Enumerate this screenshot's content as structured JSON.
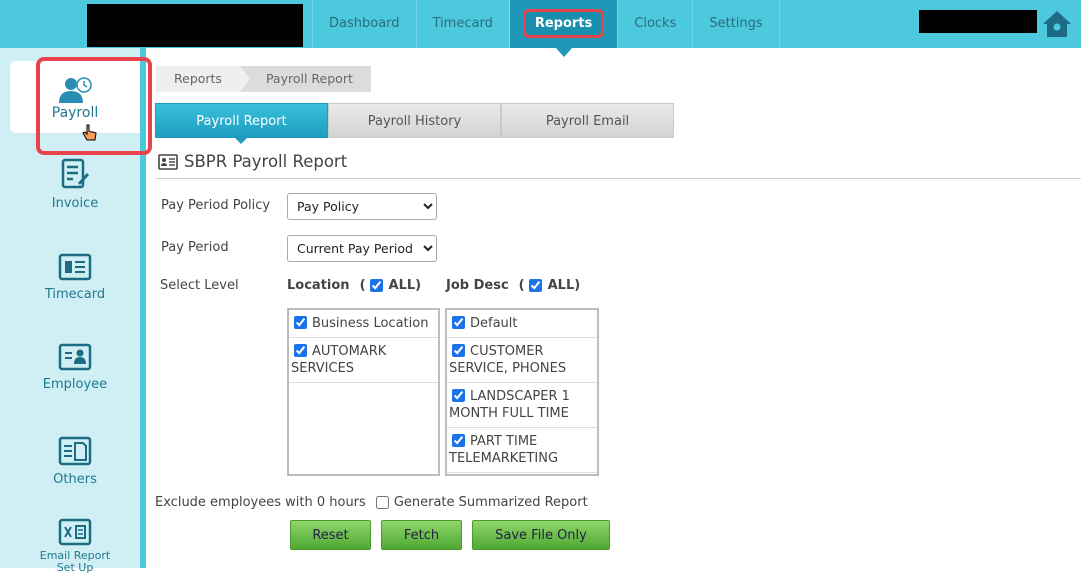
{
  "nav": {
    "items": [
      {
        "label": "Dashboard"
      },
      {
        "label": "Timecard"
      },
      {
        "label": "Reports"
      },
      {
        "label": "Clocks"
      },
      {
        "label": "Settings"
      }
    ],
    "active": "Reports"
  },
  "sidebar": {
    "items": [
      {
        "label": "Payroll",
        "icon": "payroll-clock-icon"
      },
      {
        "label": "Invoice",
        "icon": "invoice-icon"
      },
      {
        "label": "Timecard",
        "icon": "timecard-icon"
      },
      {
        "label": "Employee",
        "icon": "employee-icon"
      },
      {
        "label": "Others",
        "icon": "others-icon"
      },
      {
        "label": "Email Report Set Up",
        "icon": "email-report-icon"
      }
    ]
  },
  "breadcrumb": [
    "Reports",
    "Payroll Report"
  ],
  "tabs": [
    {
      "label": "Payroll Report"
    },
    {
      "label": "Payroll History"
    },
    {
      "label": "Payroll Email"
    }
  ],
  "page": {
    "title": "SBPR Payroll Report"
  },
  "form": {
    "pay_period_policy": {
      "label": "Pay Period Policy",
      "value": "Pay Policy"
    },
    "pay_period": {
      "label": "Pay Period",
      "value": "Current Pay Period"
    },
    "select_level": {
      "label": "Select Level"
    },
    "location": {
      "header": "Location",
      "all_label": "ALL",
      "items": [
        "Business Location",
        "AUTOMARK SERVICES"
      ]
    },
    "job_desc": {
      "header": "Job Desc",
      "all_label": "ALL",
      "items": [
        "Default",
        "CUSTOMER SERVICE, PHONES",
        "LANDSCAPER 1 MONTH FULL TIME",
        "PART TIME TELEMARKETING"
      ]
    },
    "exclude_label": "Exclude employees with 0 hours",
    "summarized_label": "Generate Summarized Report"
  },
  "buttons": {
    "reset": "Reset",
    "fetch": "Fetch",
    "save": "Save File Only"
  }
}
